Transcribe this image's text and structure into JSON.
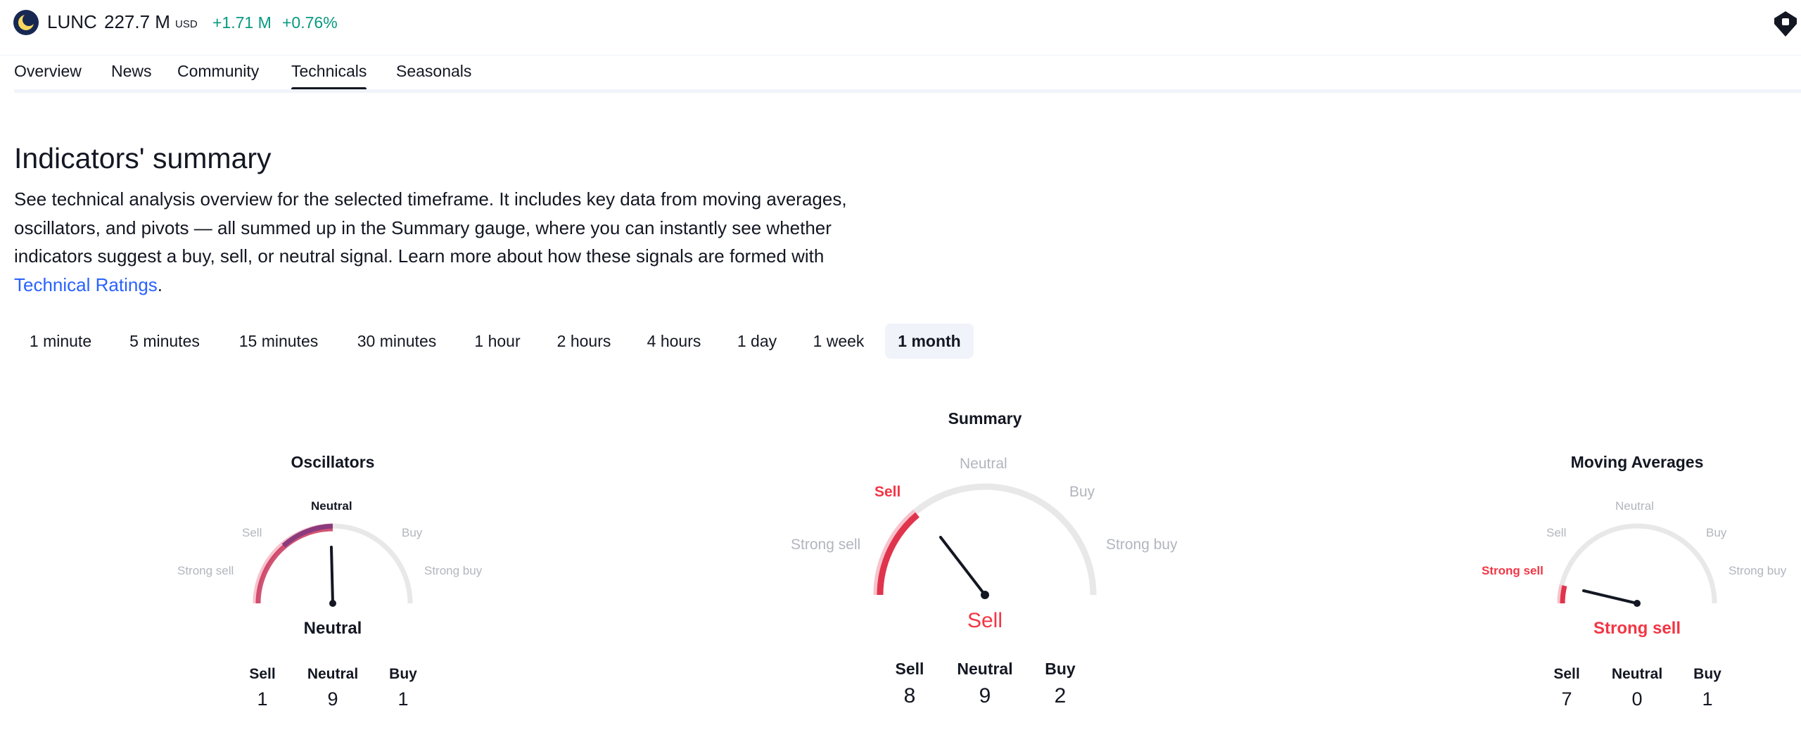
{
  "header": {
    "ticker": "LUNC",
    "price": "227.7 M",
    "currency": "USD",
    "change_abs": "+1.71 M",
    "change_pct": "+0.76%",
    "logo_icon": "lunc-coin-icon",
    "corner_icon": "badge-icon",
    "colors": {
      "positive": "#089981"
    }
  },
  "tabs": [
    {
      "label": "Overview"
    },
    {
      "label": "News"
    },
    {
      "label": "Community"
    },
    {
      "label": "Technicals",
      "active": true
    },
    {
      "label": "Seasonals"
    }
  ],
  "summary_section": {
    "title": "Indicators' summary",
    "description": "See technical analysis overview for the selected timeframe. It includes key data from moving averages, oscillators, and pivots — all summed up in the Summary gauge, where you can instantly see whether indicators suggest a buy, sell, or neutral signal. Learn more about how these signals are formed with ",
    "link_text": "Technical Ratings",
    "after_link": "."
  },
  "timeframes": {
    "options": [
      "1 minute",
      "5 minutes",
      "15 minutes",
      "30 minutes",
      "1 hour",
      "2 hours",
      "4 hours",
      "1 day",
      "1 week",
      "1 month"
    ],
    "selected": "1 month"
  },
  "scale_labels": {
    "strong_sell": "Strong sell",
    "sell": "Sell",
    "neutral": "Neutral",
    "buy": "Buy",
    "strong_buy": "Strong buy"
  },
  "gauges": {
    "oscillators": {
      "title": "Oscillators",
      "verdict": "Neutral",
      "counts": {
        "sell_label": "Sell",
        "sell": "1",
        "neutral_label": "Neutral",
        "neutral": "9",
        "buy_label": "Buy",
        "buy": "1"
      }
    },
    "summary": {
      "title": "Summary",
      "verdict": "Sell",
      "counts": {
        "sell_label": "Sell",
        "sell": "8",
        "neutral_label": "Neutral",
        "neutral": "9",
        "buy_label": "Buy",
        "buy": "2"
      }
    },
    "moving_averages": {
      "title": "Moving Averages",
      "verdict": "Strong sell",
      "counts": {
        "sell_label": "Sell",
        "sell": "7",
        "neutral_label": "Neutral",
        "neutral": "0",
        "buy_label": "Buy",
        "buy": "1"
      }
    }
  },
  "colors": {
    "sell": "#f23645",
    "sell_light": "#f7a9b3",
    "neutral_arc": "#8c3a7e",
    "track": "#e8e8e8",
    "link": "#2962ff"
  }
}
